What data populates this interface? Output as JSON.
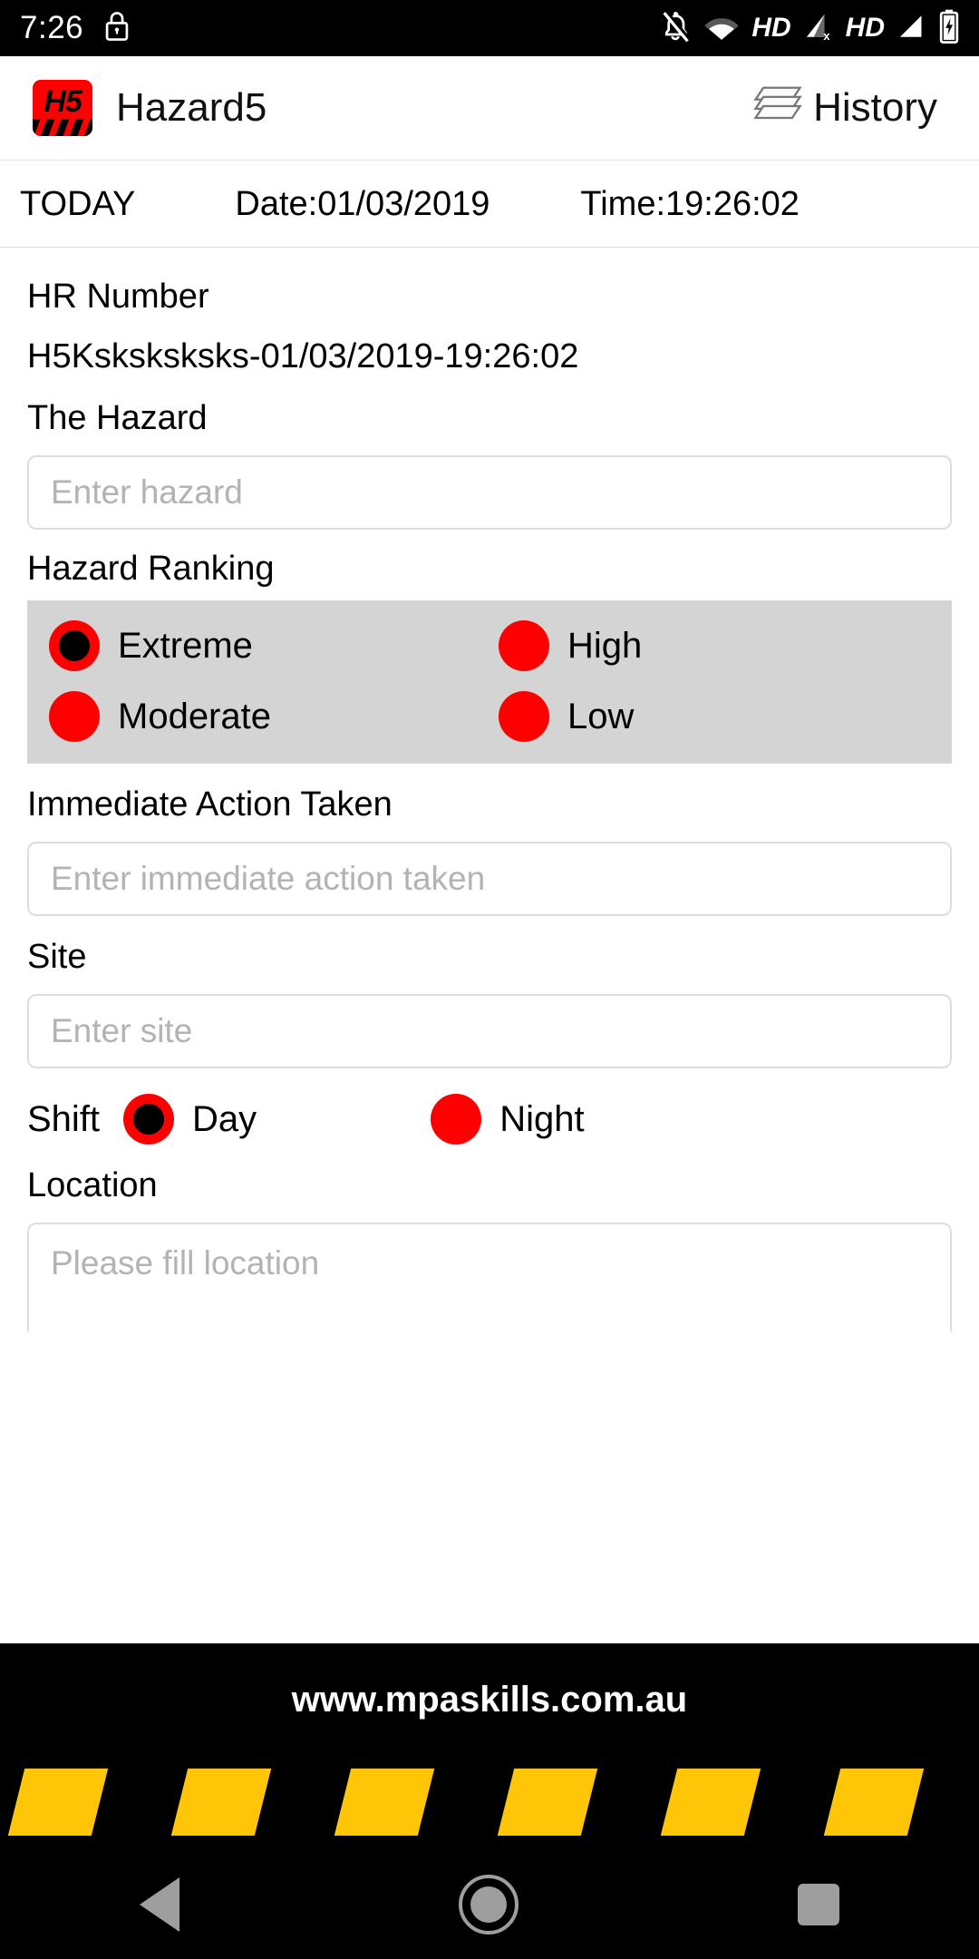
{
  "statusbar": {
    "time": "7:26",
    "icons": [
      "lock-icon",
      "bell-off-icon",
      "wifi-icon",
      "signal-x-icon",
      "signal-icon",
      "battery-charging-icon"
    ],
    "hd_label_1": "HD",
    "hd_label_2": "HD"
  },
  "appbar": {
    "logo_text": "H5",
    "title": "Hazard5",
    "history_label": "History"
  },
  "daterow": {
    "today": "TODAY",
    "date": "Date:01/03/2019",
    "time": "Time:19:26:02"
  },
  "form": {
    "hr_number_label": "HR Number",
    "hr_number_value": "H5Ksksksksks-01/03/2019-19:26:02",
    "hazard_label": "The Hazard",
    "hazard_placeholder": "Enter hazard",
    "hazard_value": "",
    "ranking_label": "Hazard Ranking",
    "ranking_options": [
      {
        "label": "Extreme",
        "selected": true
      },
      {
        "label": "High",
        "selected": false
      },
      {
        "label": "Moderate",
        "selected": false
      },
      {
        "label": "Low",
        "selected": false
      }
    ],
    "action_label": "Immediate Action Taken",
    "action_placeholder": "Enter immediate action taken",
    "action_value": "",
    "site_label": "Site",
    "site_placeholder": "Enter site",
    "site_value": "",
    "shift_label": "Shift",
    "shift_options": [
      {
        "label": "Day",
        "selected": true
      },
      {
        "label": "Night",
        "selected": false
      }
    ],
    "location_label": "Location",
    "location_placeholder": "Please fill location",
    "location_value": ""
  },
  "footer": {
    "url": "www.mpaskills.com.au",
    "stripe_count": 6,
    "stripe_color": "#FFC608"
  },
  "navbar": {
    "back": "back-icon",
    "home": "home-icon",
    "recent": "recents-icon"
  },
  "colors": {
    "accent_red": "#FF0000",
    "panel_gray": "#D4D4D4",
    "footer_yellow": "#FFC608"
  }
}
